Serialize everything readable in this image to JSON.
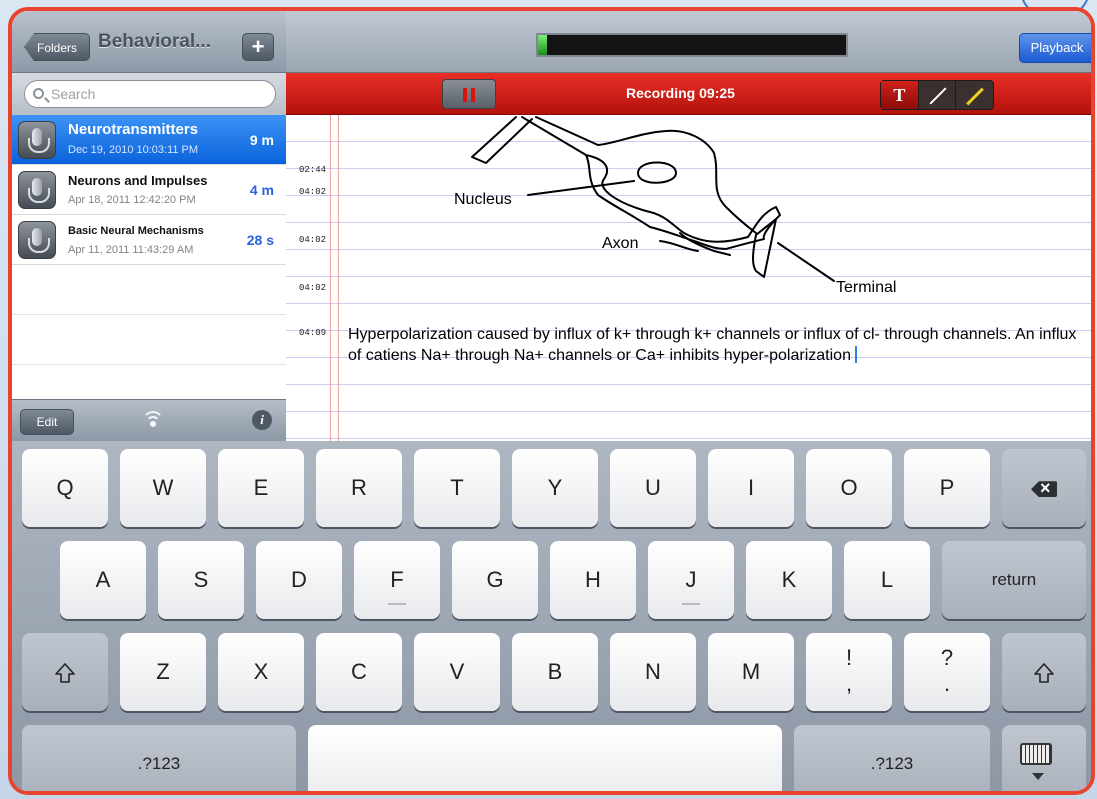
{
  "sidebar": {
    "folders_label": "Folders",
    "title": "Behavioral...",
    "add_label": "+",
    "search_placeholder": "Search",
    "recordings": [
      {
        "title": "Neurotransmitters",
        "date": "Dec 19, 2010 10:03:11 PM",
        "duration": "9 m",
        "selected": true
      },
      {
        "title": "Neurons and Impulses",
        "date": "Apr 18, 2011 12:42:20 PM",
        "duration": "4 m",
        "selected": false
      },
      {
        "title": "Basic Neural Mechanisms",
        "date": "Apr 11, 2011 11:43:29 AM",
        "duration": "28 s",
        "selected": false
      }
    ],
    "edit_label": "Edit",
    "info_label": "i"
  },
  "toolbar": {
    "playback_label": "Playback",
    "level_fraction": 0.03,
    "recording_status": "Recording 09:25",
    "text_tool_label": "T"
  },
  "notes": {
    "timestamps": [
      "02:44",
      "04:02",
      "04:02",
      "04:02",
      "04:09"
    ],
    "sketch_labels": {
      "nucleus": "Nucleus",
      "axon": "Axon",
      "terminal": "Terminal"
    },
    "text": "Hyperpolarization caused by influx of k+ through k+ channels or influx of cl- through channels. An influx of catiens Na+ through Na+ channels or Ca+ inhibits hyper-polarization"
  },
  "keyboard": {
    "row1": [
      "Q",
      "W",
      "E",
      "R",
      "T",
      "Y",
      "U",
      "I",
      "O",
      "P"
    ],
    "row2": [
      "A",
      "S",
      "D",
      "F",
      "G",
      "H",
      "J",
      "K",
      "L"
    ],
    "row3": [
      "Z",
      "X",
      "C",
      "V",
      "B",
      "N",
      "M"
    ],
    "return_label": "return",
    "numbers_label": ".?123",
    "punct_exclaim": [
      "!",
      ","
    ],
    "punct_question": [
      "?",
      "."
    ]
  },
  "colors": {
    "recording_bar": "#d0201a",
    "selected_row": "#1a72e8",
    "playback_button": "#2f6fe0",
    "frame": "#e8432f",
    "level_meter": "#2fbf2f",
    "pen_tool": "#f0d020"
  }
}
